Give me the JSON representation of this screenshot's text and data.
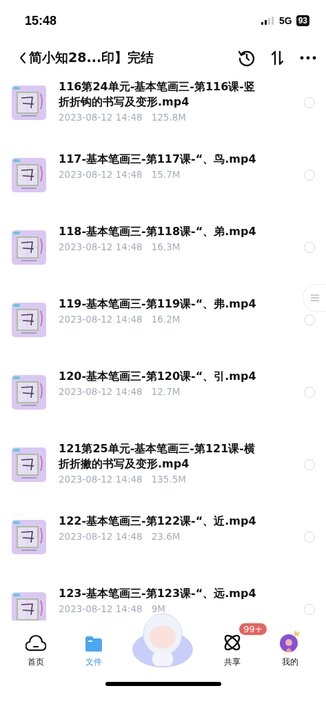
{
  "status_bar": {
    "time": "15:48",
    "network": "5G",
    "battery": "93"
  },
  "header": {
    "title": "简小知28...印】完结"
  },
  "files": [
    {
      "name": "116第24单元-基本笔画三-第116课-竖折折钩的书写及变形.mp4",
      "date": "2023-08-12 14:48",
      "size": "125.8M",
      "selected": false
    },
    {
      "name": "117-基本笔画三-第117课-“、鸟.mp4",
      "date": "2023-08-12 14:48",
      "size": "15.7M",
      "selected": false
    },
    {
      "name": "118-基本笔画三-第118课-“、弟.mp4",
      "date": "2023-08-12 14:48",
      "size": "16.3M",
      "selected": false
    },
    {
      "name": "119-基本笔画三-第119课-“、弗.mp4",
      "date": "2023-08-12 14:48",
      "size": "16.2M",
      "selected": false
    },
    {
      "name": "120-基本笔画三-第120课-“、引.mp4",
      "date": "2023-08-12 14:48",
      "size": "12.7M",
      "selected": false
    },
    {
      "name": "121第25单元-基本笔画三-第121课-横折折撇的书写及变形.mp4",
      "date": "2023-08-12 14:48",
      "size": "135.5M",
      "selected": false
    },
    {
      "name": "122-基本笔画三-第122课-“、近.mp4",
      "date": "2023-08-12 14:48",
      "size": "23.6M",
      "selected": false
    },
    {
      "name": "123-基本笔画三-第123课-“、远.mp4",
      "date": "2023-08-12 14:48",
      "size": "9M",
      "selected": false
    }
  ],
  "nav": [
    {
      "label": "首页",
      "kind": "home",
      "selected": false
    },
    {
      "label": "文件",
      "kind": "files",
      "selected": true
    },
    {
      "kind": "mascot"
    },
    {
      "label": "共享",
      "kind": "share",
      "selected": false,
      "badge": "99+"
    },
    {
      "label": "我的",
      "kind": "me",
      "selected": false
    }
  ]
}
